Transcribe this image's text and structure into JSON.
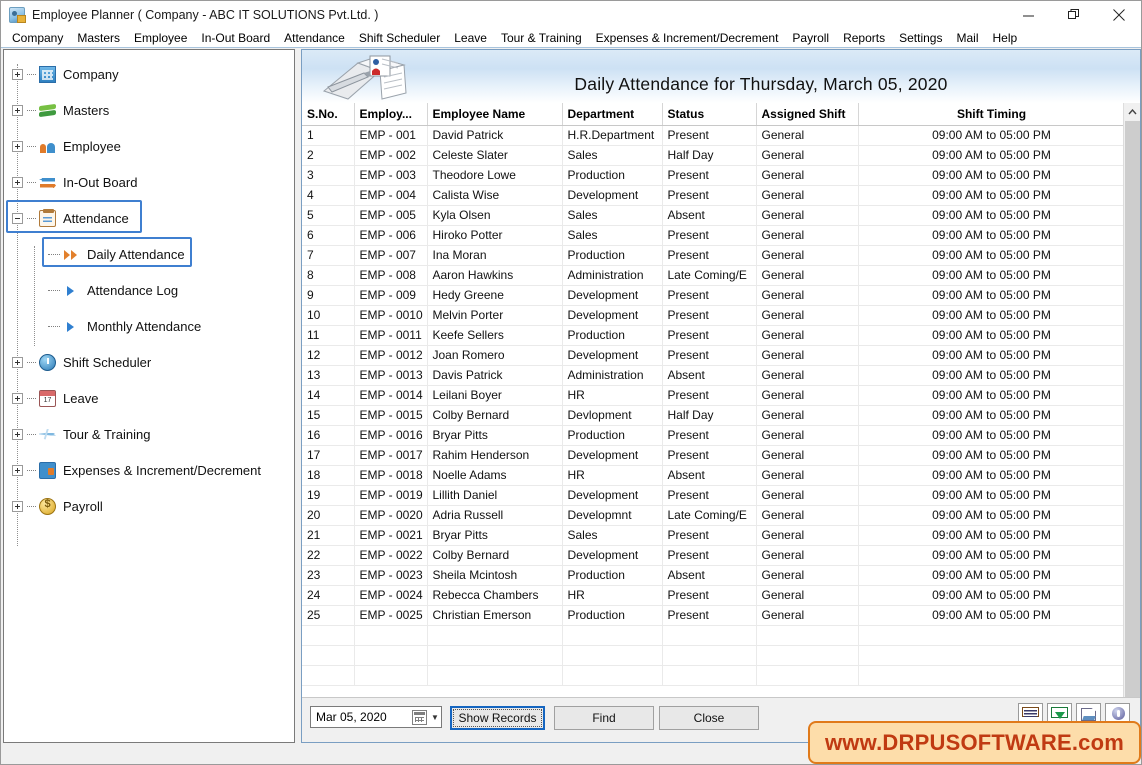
{
  "window": {
    "title": "Employee Planner ( Company - ABC IT SOLUTIONS Pvt.Ltd. )",
    "icon": "app-icon",
    "minimize": "—",
    "maximize": "❐",
    "close": "✕"
  },
  "menubar": {
    "items": [
      "Company",
      "Masters",
      "Employee",
      "In-Out Board",
      "Attendance",
      "Shift Scheduler",
      "Leave",
      "Tour & Training",
      "Expenses & Increment/Decrement",
      "Payroll",
      "Reports",
      "Settings",
      "Mail",
      "Help"
    ]
  },
  "sidebar": {
    "items": [
      {
        "label": "Company",
        "icon": "company-icon",
        "expander": "plus",
        "level": 1,
        "selected": false
      },
      {
        "label": "Masters",
        "icon": "masters-icon",
        "expander": "plus",
        "level": 1,
        "selected": false
      },
      {
        "label": "Employee",
        "icon": "employee-icon",
        "expander": "plus",
        "level": 1,
        "selected": false
      },
      {
        "label": "In-Out Board",
        "icon": "in-out-icon",
        "expander": "plus",
        "level": 1,
        "selected": false
      },
      {
        "label": "Attendance",
        "icon": "attendance-icon",
        "expander": "minus",
        "level": 1,
        "selected": true
      },
      {
        "label": "Daily Attendance",
        "icon": "double-arrow-icon",
        "expander": "none",
        "level": 2,
        "selected": true
      },
      {
        "label": "Attendance Log",
        "icon": "arrow-icon",
        "expander": "none",
        "level": 2,
        "selected": false
      },
      {
        "label": "Monthly Attendance",
        "icon": "arrow-icon",
        "expander": "none",
        "level": 2,
        "selected": false
      },
      {
        "label": "Shift Scheduler",
        "icon": "clock-icon",
        "expander": "plus",
        "level": 1,
        "selected": false
      },
      {
        "label": "Leave",
        "icon": "calendar-icon",
        "expander": "plus",
        "level": 1,
        "selected": false
      },
      {
        "label": "Tour & Training",
        "icon": "plane-icon",
        "expander": "plus",
        "level": 1,
        "selected": false
      },
      {
        "label": "Expenses & Increment/Decrement",
        "icon": "wallet-icon",
        "expander": "plus",
        "level": 1,
        "selected": false
      },
      {
        "label": "Payroll",
        "icon": "coin-icon",
        "expander": "plus",
        "level": 1,
        "selected": false
      }
    ]
  },
  "main": {
    "banner_title": "Daily Attendance for Thursday, March 05, 2020",
    "banner_icon": "notebook-pen-icon"
  },
  "grid": {
    "columns": [
      {
        "label": "S.No.",
        "align": "left"
      },
      {
        "label": "Employ...",
        "align": "left"
      },
      {
        "label": "Employee Name",
        "align": "left"
      },
      {
        "label": "Department",
        "align": "left"
      },
      {
        "label": "Status",
        "align": "left"
      },
      {
        "label": "Assigned Shift",
        "align": "left"
      },
      {
        "label": "Shift Timing",
        "align": "center"
      }
    ],
    "empty_rows": 3,
    "rows": [
      {
        "sno": "1",
        "code": "EMP - 001",
        "name": "David Patrick",
        "dept": "H.R.Department",
        "status": "Present",
        "status_kind": "present",
        "shift": "General",
        "timing": "09:00 AM to 05:00 PM"
      },
      {
        "sno": "2",
        "code": "EMP - 002",
        "name": "Celeste Slater",
        "dept": "Sales",
        "status": "Half Day",
        "status_kind": "half",
        "shift": "General",
        "timing": "09:00 AM to 05:00 PM"
      },
      {
        "sno": "3",
        "code": "EMP - 003",
        "name": "Theodore Lowe",
        "dept": "Production",
        "status": "Present",
        "status_kind": "present",
        "shift": "General",
        "timing": "09:00 AM to 05:00 PM"
      },
      {
        "sno": "4",
        "code": "EMP - 004",
        "name": "Calista Wise",
        "dept": "Development",
        "status": "Present",
        "status_kind": "present",
        "shift": "General",
        "timing": "09:00 AM to 05:00 PM"
      },
      {
        "sno": "5",
        "code": "EMP - 005",
        "name": "Kyla Olsen",
        "dept": "Sales",
        "status": "Absent",
        "status_kind": "absent",
        "shift": "General",
        "timing": "09:00 AM to 05:00 PM"
      },
      {
        "sno": "6",
        "code": "EMP - 006",
        "name": "Hiroko Potter",
        "dept": "Sales",
        "status": "Present",
        "status_kind": "present",
        "shift": "General",
        "timing": "09:00 AM to 05:00 PM"
      },
      {
        "sno": "7",
        "code": "EMP - 007",
        "name": "Ina Moran",
        "dept": "Production",
        "status": "Present",
        "status_kind": "present",
        "shift": "General",
        "timing": "09:00 AM to 05:00 PM"
      },
      {
        "sno": "8",
        "code": "EMP - 008",
        "name": "Aaron Hawkins",
        "dept": "Administration",
        "status": "Late Coming/E",
        "status_kind": "late",
        "shift": "General",
        "timing": "09:00 AM to 05:00 PM"
      },
      {
        "sno": "9",
        "code": "EMP - 009",
        "name": "Hedy Greene",
        "dept": "Development",
        "status": "Present",
        "status_kind": "present",
        "shift": "General",
        "timing": "09:00 AM to 05:00 PM"
      },
      {
        "sno": "10",
        "code": "EMP - 0010",
        "name": "Melvin Porter",
        "dept": "Development",
        "status": "Present",
        "status_kind": "present",
        "shift": "General",
        "timing": "09:00 AM to 05:00 PM"
      },
      {
        "sno": "11",
        "code": "EMP - 0011",
        "name": "Keefe Sellers",
        "dept": "Production",
        "status": "Present",
        "status_kind": "present",
        "shift": "General",
        "timing": "09:00 AM to 05:00 PM"
      },
      {
        "sno": "12",
        "code": "EMP - 0012",
        "name": "Joan Romero",
        "dept": "Development",
        "status": "Present",
        "status_kind": "present",
        "shift": "General",
        "timing": "09:00 AM to 05:00 PM"
      },
      {
        "sno": "13",
        "code": "EMP - 0013",
        "name": "Davis Patrick",
        "dept": "Administration",
        "status": "Absent",
        "status_kind": "absent",
        "shift": "General",
        "timing": "09:00 AM to 05:00 PM"
      },
      {
        "sno": "14",
        "code": "EMP - 0014",
        "name": "Leilani Boyer",
        "dept": "HR",
        "status": "Present",
        "status_kind": "present",
        "shift": "General",
        "timing": "09:00 AM to 05:00 PM"
      },
      {
        "sno": "15",
        "code": "EMP - 0015",
        "name": "Colby Bernard",
        "dept": "Devlopment",
        "status": "Half Day",
        "status_kind": "half",
        "shift": "General",
        "timing": "09:00 AM to 05:00 PM"
      },
      {
        "sno": "16",
        "code": "EMP - 0016",
        "name": "Bryar Pitts",
        "dept": "Production",
        "status": "Present",
        "status_kind": "present",
        "shift": "General",
        "timing": "09:00 AM to 05:00 PM"
      },
      {
        "sno": "17",
        "code": "EMP - 0017",
        "name": "Rahim Henderson",
        "dept": "Development",
        "status": "Present",
        "status_kind": "present",
        "shift": "General",
        "timing": "09:00 AM to 05:00 PM"
      },
      {
        "sno": "18",
        "code": "EMP - 0018",
        "name": "Noelle Adams",
        "dept": "HR",
        "status": "Absent",
        "status_kind": "absent",
        "shift": "General",
        "timing": "09:00 AM to 05:00 PM"
      },
      {
        "sno": "19",
        "code": "EMP - 0019",
        "name": "Lillith Daniel",
        "dept": "Development",
        "status": "Present",
        "status_kind": "present",
        "shift": "General",
        "timing": "09:00 AM to 05:00 PM"
      },
      {
        "sno": "20",
        "code": "EMP - 0020",
        "name": "Adria Russell",
        "dept": "Developmnt",
        "status": "Late Coming/E",
        "status_kind": "late",
        "shift": "General",
        "timing": "09:00 AM to 05:00 PM"
      },
      {
        "sno": "21",
        "code": "EMP - 0021",
        "name": "Bryar Pitts",
        "dept": "Sales",
        "status": "Present",
        "status_kind": "present",
        "shift": "General",
        "timing": "09:00 AM to 05:00 PM"
      },
      {
        "sno": "22",
        "code": "EMP - 0022",
        "name": "Colby Bernard",
        "dept": "Development",
        "status": "Present",
        "status_kind": "present",
        "shift": "General",
        "timing": "09:00 AM to 05:00 PM"
      },
      {
        "sno": "23",
        "code": "EMP - 0023",
        "name": "Sheila Mcintosh",
        "dept": "Production",
        "status": "Absent",
        "status_kind": "absent",
        "shift": "General",
        "timing": "09:00 AM to 05:00 PM"
      },
      {
        "sno": "24",
        "code": "EMP - 0024",
        "name": "Rebecca Chambers",
        "dept": "HR",
        "status": "Present",
        "status_kind": "present",
        "shift": "General",
        "timing": "09:00 AM to 05:00 PM"
      },
      {
        "sno": "25",
        "code": "EMP - 0025",
        "name": "Christian Emerson",
        "dept": "Production",
        "status": "Present",
        "status_kind": "present",
        "shift": "General",
        "timing": "09:00 AM to 05:00 PM"
      }
    ]
  },
  "footer": {
    "date_value": "Mar 05, 2020",
    "show_records_label": "Show Records",
    "find_label": "Find",
    "close_label": "Close",
    "icons": [
      "report-icon",
      "excel-export-icon",
      "print-icon",
      "help-icon"
    ]
  },
  "watermark": {
    "text": "www.DRPUSOFTWARE.com"
  },
  "colors": {
    "accent": "#3f7fd0",
    "present": "#1a8f2a",
    "absent": "#ee2222",
    "half_day": "#a01050",
    "late": "#f77fc0",
    "watermark_bg": "#fdddaa",
    "watermark_text": "#c03a12",
    "watermark_border": "#e07a1a"
  }
}
